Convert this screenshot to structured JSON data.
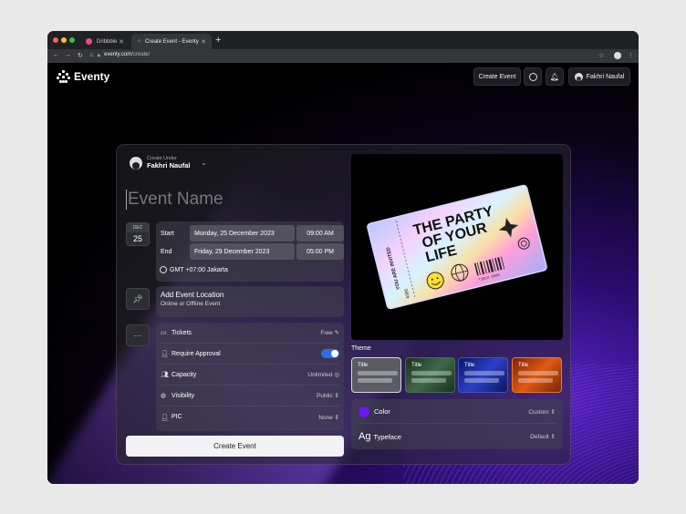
{
  "browser": {
    "tabs": [
      {
        "title": "Dribbble",
        "close": "✕"
      },
      {
        "title": "Create Event - Eventy",
        "close": "✕"
      }
    ],
    "new_tab": "+",
    "url_host": "eventy.com",
    "url_path": "/create/"
  },
  "header": {
    "logo": "Eventy",
    "create_event": "Create Event",
    "user_name": "Fakhri Naufal"
  },
  "form": {
    "create_under_label": "Create Under",
    "create_under_name": "Fakhri Naufal",
    "event_name_placeholder": "Event Name",
    "date_badge_month": "DEC",
    "date_badge_day": "25",
    "start_label": "Start",
    "start_date": "Monday, 25 December 2023",
    "start_time": "09:00 AM",
    "end_label": "End",
    "end_date": "Friday, 29 December 2023",
    "end_time": "05:00 PM",
    "timezone": "GMT +07:00 Jakarta",
    "location_title": "Add Event Location",
    "location_subtitle": "Online or Offline Event",
    "options": {
      "tickets_label": "Tickets",
      "tickets_value": "Free",
      "approval_label": "Require Approval",
      "approval_on": true,
      "capacity_label": "Capacity",
      "capacity_value": "Unlimited",
      "visibility_label": "Visibility",
      "visibility_value": "Public",
      "pic_label": "PIC",
      "pic_value": "None"
    },
    "submit": "Create Event"
  },
  "poster": {
    "headline_1": "THE PARTY",
    "headline_2": "OF YOUR",
    "headline_3": "LIFE",
    "side_text": "YOU ARE INVITED",
    "barcode_text": "*1D12 2005",
    "ticket_no": "4385"
  },
  "theme": {
    "label": "Theme",
    "options": [
      {
        "title": "Title",
        "bg": "#5b5b66"
      },
      {
        "title": "Title",
        "bg": "#24402d"
      },
      {
        "title": "Title",
        "bg": "#1d2a8a"
      },
      {
        "title": "Title",
        "bg": "#c24a10"
      }
    ]
  },
  "settings": {
    "color_label": "Color",
    "color_value": "Custom",
    "color_swatch": "#6a18f0",
    "typeface_icon": "Ag",
    "typeface_label": "Typeface",
    "typeface_value": "Default"
  },
  "colors": {
    "accent": "#6a18f0",
    "toggle_on": "#2f6fe4"
  }
}
